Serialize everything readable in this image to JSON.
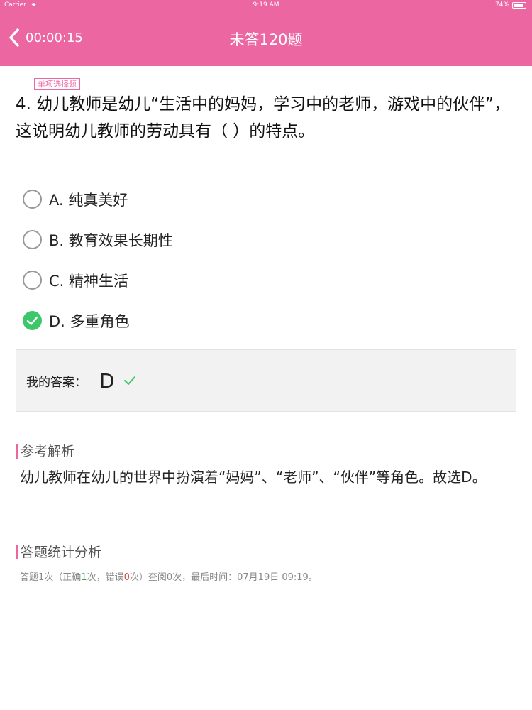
{
  "status_bar": {
    "carrier": "Carrier",
    "time": "9:19 AM",
    "battery": "74%"
  },
  "nav": {
    "timer": "00:00:15",
    "title": "未答120题"
  },
  "question": {
    "type_badge": "单项选择题",
    "text": "4. 幼儿教师是幼儿“生活中的妈妈，学习中的老师，游戏中的伙伴”，这说明幼儿教师的劳动具有（    ）的特点。",
    "options": [
      {
        "label": "A. 纯真美好",
        "selected": false
      },
      {
        "label": "B. 教育效果长期性",
        "selected": false
      },
      {
        "label": "C. 精神生活",
        "selected": false
      },
      {
        "label": "D. 多重角色",
        "selected": true
      }
    ]
  },
  "my_answer": {
    "label": "我的答案：",
    "value": "D"
  },
  "explanation": {
    "title": "参考解析",
    "text": "幼儿教师在幼儿的世界中扮演着“妈妈”、“老师”、“伙伴”等角色。故选D。"
  },
  "statistics": {
    "title": "答题统计分析",
    "prefix": "答题1次（正确",
    "correct_count": "1",
    "middle": "次，错误",
    "wrong_count": "0",
    "suffix": "次）查阅0次，最后时间：07月19日 09:19。"
  },
  "colors": {
    "brand": "#ec66a1",
    "correct": "#3cc86a",
    "wrong": "#e8453c"
  }
}
